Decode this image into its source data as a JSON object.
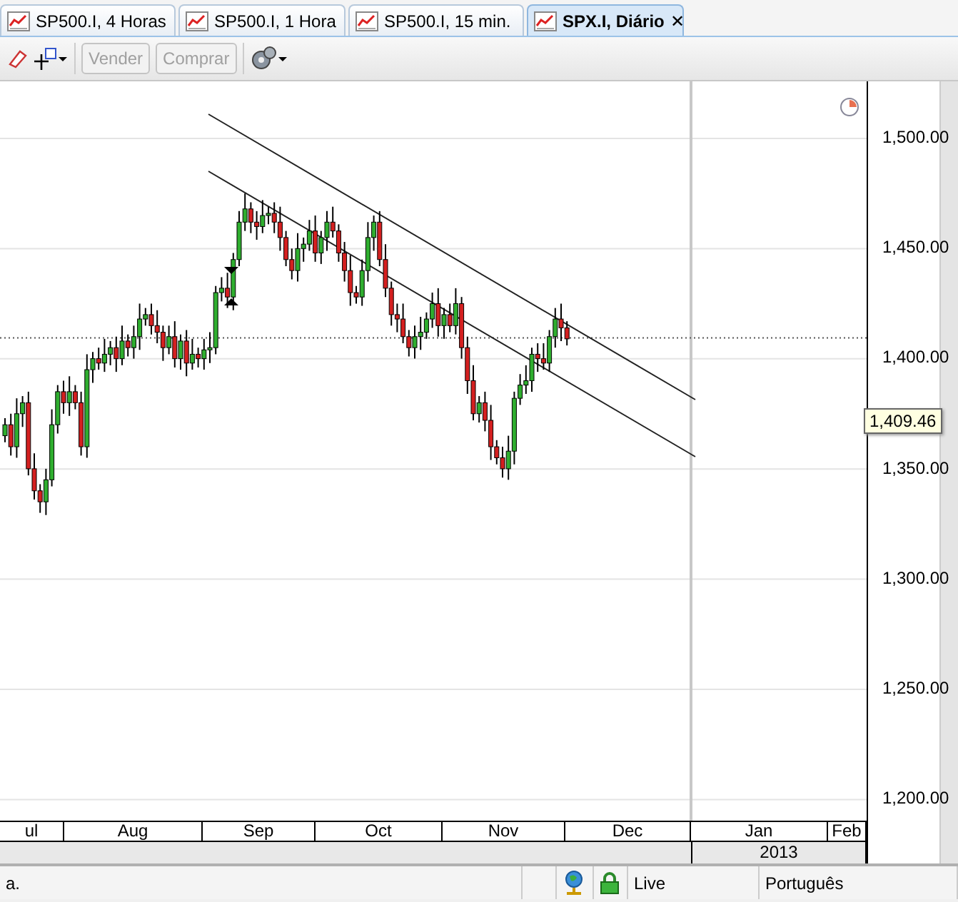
{
  "tabs": [
    {
      "label": "SP500.I, 4 Horas",
      "selected": false
    },
    {
      "label": "SP500.I, 1 Hora",
      "selected": false
    },
    {
      "label": "SP500.I, 15 min.",
      "selected": false
    },
    {
      "label": "SPX.I, Diário",
      "selected": true,
      "close": "✕"
    }
  ],
  "toolbar": {
    "buttons": [
      {
        "label": "Vender",
        "disabled": true
      },
      {
        "label": "Comprar",
        "disabled": true
      }
    ]
  },
  "chart": {
    "price_labels": [
      "1,500.00",
      "1,450.00",
      "1,400.00",
      "1,350.00",
      "1,300.00",
      "1,250.00",
      "1,200.00"
    ],
    "current_price": "1,409.46",
    "months": [
      "ul",
      "Aug",
      "Sep",
      "Oct",
      "Nov",
      "Dec",
      "Jan",
      "Feb"
    ],
    "year": "2013"
  },
  "status_bar": {
    "message": "a.",
    "connection": "Live",
    "language": "Português"
  }
}
